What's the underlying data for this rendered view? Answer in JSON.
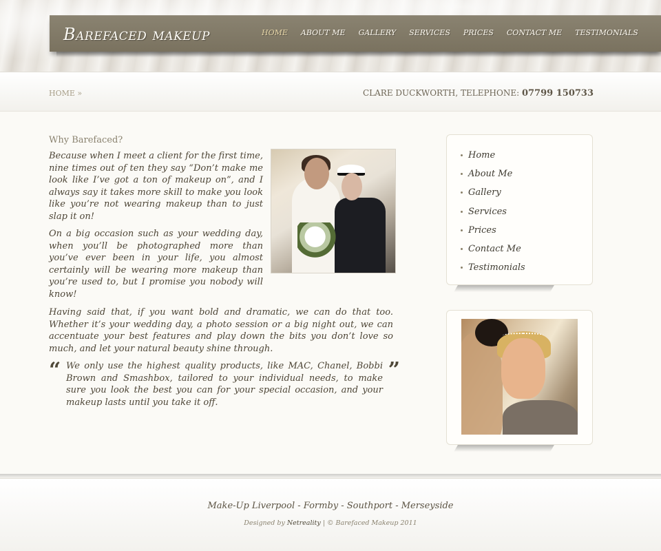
{
  "header": {
    "logo": "Barefaced makeup",
    "nav": [
      {
        "label": "HOME",
        "active": true
      },
      {
        "label": "ABOUT ME",
        "active": false
      },
      {
        "label": "GALLERY",
        "active": false
      },
      {
        "label": "SERVICES",
        "active": false
      },
      {
        "label": "PRICES",
        "active": false
      },
      {
        "label": "CONTACT ME",
        "active": false
      },
      {
        "label": "TESTIMONIALS",
        "active": false
      }
    ]
  },
  "breadcrumb": {
    "label": "HOME »"
  },
  "contact": {
    "name_label": "CLARE DUCKWORTH, TELEPHONE:",
    "phone": "07799 150733"
  },
  "main": {
    "heading": "Why Barefaced?",
    "paragraphs": [
      "Because when I meet a client for the first time, nine times out of ten they say “Don’t make me look like I’ve got a ton of makeup on”, and I always say it takes more skill to make you look like you’re not wearing makeup than to just slap it on!",
      "On a big occasion such as your wedding day, when you’ll be photographed more than you’ve ever been in your life, you almost certainly will be wearing more makeup than you’re used to, but I promise you nobody will know!",
      "Having said that, if you want bold and dramatic, we can do that too. Whether it’s your wedding day, a photo session or a big night out, we can accentuate your best features and play down the bits you don’t love so much, and let your natural beauty shine through."
    ],
    "quote": "We only use the highest quality products, like MAC, Chanel, Bobbi Brown and Smashbox, tailored to your individual needs, to make sure you look the best you can for your special occasion, and your makeup lasts until you take it off.",
    "quote_open": "“",
    "quote_close": "”"
  },
  "sidebar": {
    "items": [
      {
        "label": "Home"
      },
      {
        "label": "About Me"
      },
      {
        "label": "Gallery"
      },
      {
        "label": "Services"
      },
      {
        "label": "Prices"
      },
      {
        "label": "Contact Me"
      },
      {
        "label": "Testimonials"
      }
    ]
  },
  "footer": {
    "tagline": "Make-Up Liverpool - Formby - Southport - Merseyside",
    "designed_by": "Designed by",
    "designer": "Netreality",
    "copyright": "| © Barefaced Makeup 2011"
  },
  "colors": {
    "nav_bar": "#7f7865",
    "nav_active": "#e7d6a8",
    "page_bg": "#fbfaf6"
  }
}
